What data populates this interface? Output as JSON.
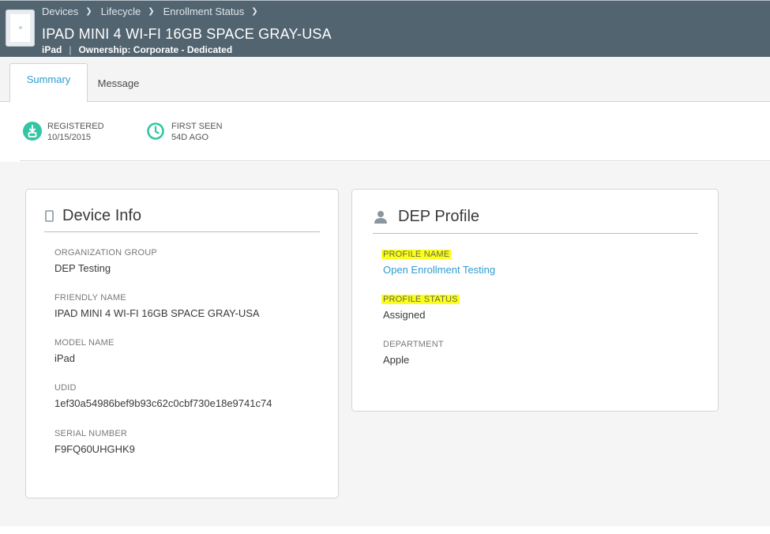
{
  "breadcrumb": [
    "Devices",
    "Lifecycle",
    "Enrollment Status"
  ],
  "header": {
    "title": "IPAD MINI 4 WI-FI 16GB SPACE GRAY-USA",
    "platform": "iPad",
    "ownership": "Ownership: Corporate - Dedicated"
  },
  "tabs": [
    {
      "label": "Summary",
      "active": true
    },
    {
      "label": "Message",
      "active": false
    }
  ],
  "status": {
    "registered_label": "REGISTERED",
    "registered_value": "10/15/2015",
    "first_seen_label": "FIRST SEEN",
    "first_seen_value": "54D AGO"
  },
  "device_info": {
    "title": "Device Info",
    "fields": [
      {
        "label": "ORGANIZATION GROUP",
        "value": "DEP Testing"
      },
      {
        "label": "FRIENDLY NAME",
        "value": "IPAD MINI 4 WI-FI 16GB SPACE GRAY-USA"
      },
      {
        "label": "MODEL NAME",
        "value": "iPad"
      },
      {
        "label": "UDID",
        "value": "1ef30a54986bef9b93c62c0cbf730e18e9741c74"
      },
      {
        "label": "SERIAL NUMBER",
        "value": "F9FQ60UHGHK9"
      }
    ]
  },
  "dep_profile": {
    "title": "DEP Profile",
    "fields": [
      {
        "label": "PROFILE NAME",
        "value": "Open Enrollment Testing"
      },
      {
        "label": "PROFILE STATUS",
        "value": "Assigned"
      },
      {
        "label": "DEPARTMENT",
        "value": "Apple"
      }
    ]
  },
  "colors": {
    "header_bg": "#526470",
    "accent_blue": "#2d9cd1",
    "status_green": "#33c6a5",
    "highlight_yellow": "#fbff1d"
  },
  "icons": [
    "device-thumbnail",
    "chevron-right-icon",
    "registered-icon",
    "clock-icon",
    "tablet-icon",
    "user-icon"
  ]
}
